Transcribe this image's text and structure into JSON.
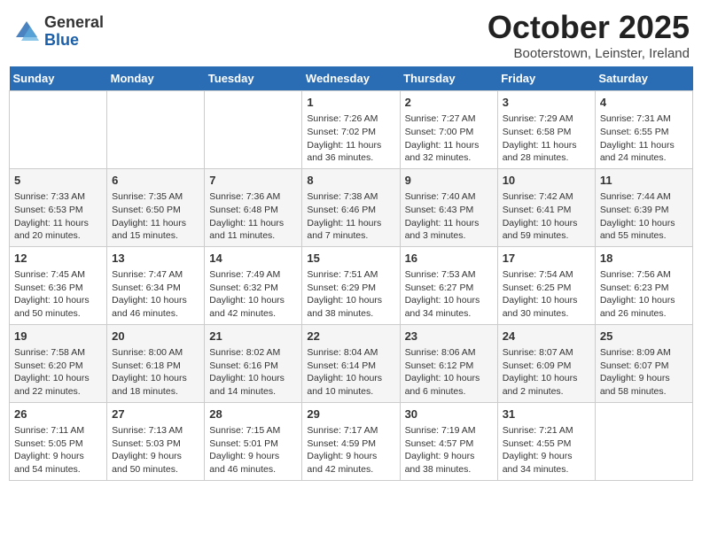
{
  "header": {
    "logo_general": "General",
    "logo_blue": "Blue",
    "month": "October 2025",
    "location": "Booterstown, Leinster, Ireland"
  },
  "days_of_week": [
    "Sunday",
    "Monday",
    "Tuesday",
    "Wednesday",
    "Thursday",
    "Friday",
    "Saturday"
  ],
  "weeks": [
    [
      {
        "day": "",
        "info": ""
      },
      {
        "day": "",
        "info": ""
      },
      {
        "day": "",
        "info": ""
      },
      {
        "day": "1",
        "info": "Sunrise: 7:26 AM\nSunset: 7:02 PM\nDaylight: 11 hours and 36 minutes."
      },
      {
        "day": "2",
        "info": "Sunrise: 7:27 AM\nSunset: 7:00 PM\nDaylight: 11 hours and 32 minutes."
      },
      {
        "day": "3",
        "info": "Sunrise: 7:29 AM\nSunset: 6:58 PM\nDaylight: 11 hours and 28 minutes."
      },
      {
        "day": "4",
        "info": "Sunrise: 7:31 AM\nSunset: 6:55 PM\nDaylight: 11 hours and 24 minutes."
      }
    ],
    [
      {
        "day": "5",
        "info": "Sunrise: 7:33 AM\nSunset: 6:53 PM\nDaylight: 11 hours and 20 minutes."
      },
      {
        "day": "6",
        "info": "Sunrise: 7:35 AM\nSunset: 6:50 PM\nDaylight: 11 hours and 15 minutes."
      },
      {
        "day": "7",
        "info": "Sunrise: 7:36 AM\nSunset: 6:48 PM\nDaylight: 11 hours and 11 minutes."
      },
      {
        "day": "8",
        "info": "Sunrise: 7:38 AM\nSunset: 6:46 PM\nDaylight: 11 hours and 7 minutes."
      },
      {
        "day": "9",
        "info": "Sunrise: 7:40 AM\nSunset: 6:43 PM\nDaylight: 11 hours and 3 minutes."
      },
      {
        "day": "10",
        "info": "Sunrise: 7:42 AM\nSunset: 6:41 PM\nDaylight: 10 hours and 59 minutes."
      },
      {
        "day": "11",
        "info": "Sunrise: 7:44 AM\nSunset: 6:39 PM\nDaylight: 10 hours and 55 minutes."
      }
    ],
    [
      {
        "day": "12",
        "info": "Sunrise: 7:45 AM\nSunset: 6:36 PM\nDaylight: 10 hours and 50 minutes."
      },
      {
        "day": "13",
        "info": "Sunrise: 7:47 AM\nSunset: 6:34 PM\nDaylight: 10 hours and 46 minutes."
      },
      {
        "day": "14",
        "info": "Sunrise: 7:49 AM\nSunset: 6:32 PM\nDaylight: 10 hours and 42 minutes."
      },
      {
        "day": "15",
        "info": "Sunrise: 7:51 AM\nSunset: 6:29 PM\nDaylight: 10 hours and 38 minutes."
      },
      {
        "day": "16",
        "info": "Sunrise: 7:53 AM\nSunset: 6:27 PM\nDaylight: 10 hours and 34 minutes."
      },
      {
        "day": "17",
        "info": "Sunrise: 7:54 AM\nSunset: 6:25 PM\nDaylight: 10 hours and 30 minutes."
      },
      {
        "day": "18",
        "info": "Sunrise: 7:56 AM\nSunset: 6:23 PM\nDaylight: 10 hours and 26 minutes."
      }
    ],
    [
      {
        "day": "19",
        "info": "Sunrise: 7:58 AM\nSunset: 6:20 PM\nDaylight: 10 hours and 22 minutes."
      },
      {
        "day": "20",
        "info": "Sunrise: 8:00 AM\nSunset: 6:18 PM\nDaylight: 10 hours and 18 minutes."
      },
      {
        "day": "21",
        "info": "Sunrise: 8:02 AM\nSunset: 6:16 PM\nDaylight: 10 hours and 14 minutes."
      },
      {
        "day": "22",
        "info": "Sunrise: 8:04 AM\nSunset: 6:14 PM\nDaylight: 10 hours and 10 minutes."
      },
      {
        "day": "23",
        "info": "Sunrise: 8:06 AM\nSunset: 6:12 PM\nDaylight: 10 hours and 6 minutes."
      },
      {
        "day": "24",
        "info": "Sunrise: 8:07 AM\nSunset: 6:09 PM\nDaylight: 10 hours and 2 minutes."
      },
      {
        "day": "25",
        "info": "Sunrise: 8:09 AM\nSunset: 6:07 PM\nDaylight: 9 hours and 58 minutes."
      }
    ],
    [
      {
        "day": "26",
        "info": "Sunrise: 7:11 AM\nSunset: 5:05 PM\nDaylight: 9 hours and 54 minutes."
      },
      {
        "day": "27",
        "info": "Sunrise: 7:13 AM\nSunset: 5:03 PM\nDaylight: 9 hours and 50 minutes."
      },
      {
        "day": "28",
        "info": "Sunrise: 7:15 AM\nSunset: 5:01 PM\nDaylight: 9 hours and 46 minutes."
      },
      {
        "day": "29",
        "info": "Sunrise: 7:17 AM\nSunset: 4:59 PM\nDaylight: 9 hours and 42 minutes."
      },
      {
        "day": "30",
        "info": "Sunrise: 7:19 AM\nSunset: 4:57 PM\nDaylight: 9 hours and 38 minutes."
      },
      {
        "day": "31",
        "info": "Sunrise: 7:21 AM\nSunset: 4:55 PM\nDaylight: 9 hours and 34 minutes."
      },
      {
        "day": "",
        "info": ""
      }
    ]
  ]
}
